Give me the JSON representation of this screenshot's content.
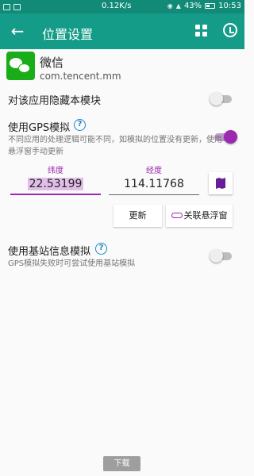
{
  "status": {
    "speed": "0.12K/s",
    "battery": "43%",
    "time": "10:53"
  },
  "appbar": {
    "title": "位置设置",
    "back_icon": "back-arrow-icon",
    "grid_icon": "widgets-icon",
    "history_icon": "history-icon"
  },
  "app": {
    "name": "微信",
    "package": "com.tencent.mm"
  },
  "hide_module": {
    "label": "对该应用隐藏本模块",
    "enabled": false
  },
  "gps": {
    "label": "使用GPS模拟",
    "enabled": true,
    "description": "不同应用的处理逻辑可能不同，如模拟的位置没有更新，使用悬浮窗手动更新",
    "lat_label": "纬度",
    "lat_value": "22.53199",
    "lng_label": "经度",
    "lng_value": "114.11768",
    "update_button": "更新",
    "link_float_button": "关联悬浮窗"
  },
  "cell": {
    "label": "使用基站信息模拟",
    "enabled": false,
    "description": "GPS模拟失败时可尝试使用基站模拟"
  },
  "download_button": "下载",
  "colors": {
    "appbar": "#159c88",
    "accent": "#9c27b0",
    "help": "#1e88c8"
  }
}
